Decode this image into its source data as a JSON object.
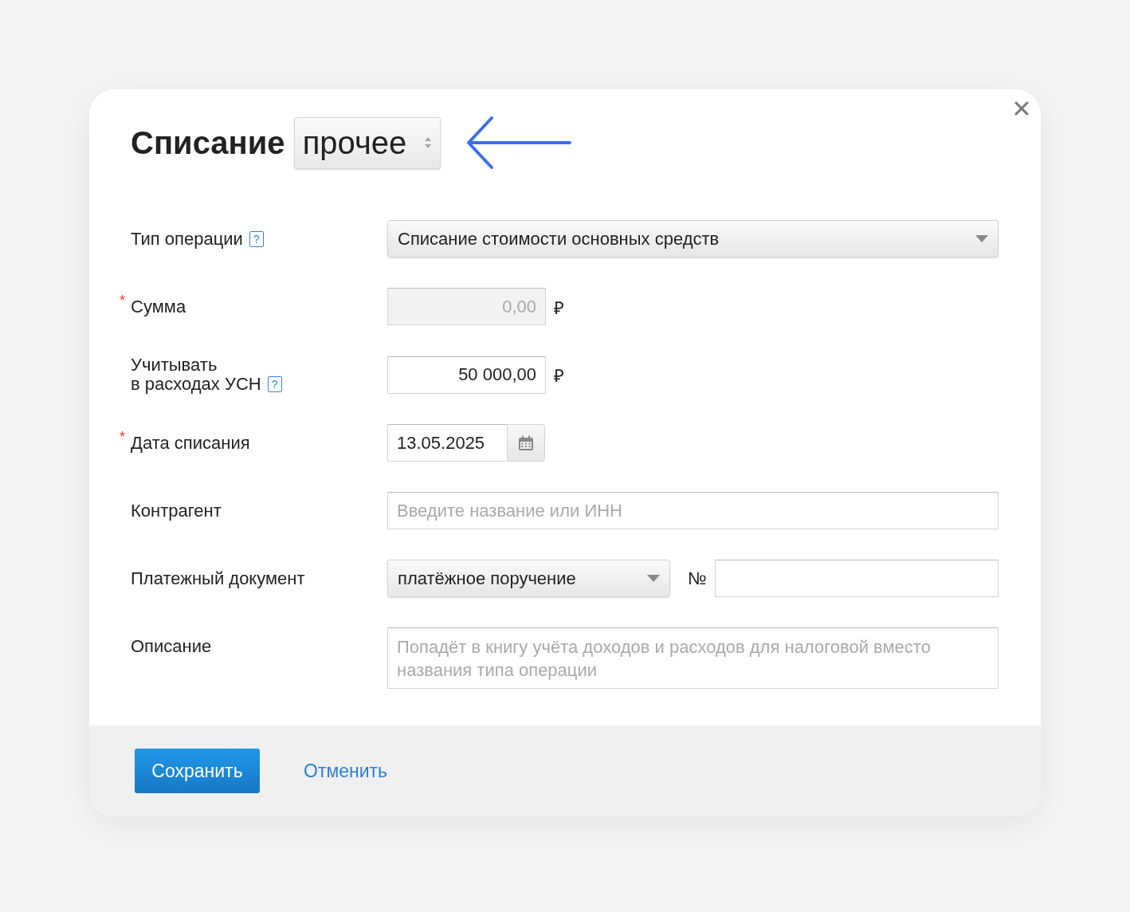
{
  "dialog": {
    "title": "Списание",
    "type_select": {
      "value": "прочее"
    }
  },
  "fields": [
    {
      "kind": "select",
      "label": "Тип операции",
      "help": "?",
      "value": "Списание стоимости основных средств"
    },
    {
      "kind": "amount",
      "label": "Сумма",
      "required_mark": "*",
      "value": "0,00",
      "disabled": true,
      "currency": "₽"
    },
    {
      "kind": "amount",
      "label": "Учитывать\nв расходах УСН",
      "help": "?",
      "value": "50 000,00",
      "disabled": false,
      "currency": "₽"
    },
    {
      "kind": "date",
      "label": "Дата списания",
      "required_mark": "*",
      "value": "13.05.2025"
    },
    {
      "kind": "text",
      "label": "Контрагент",
      "placeholder": "Введите название или ИНН"
    },
    {
      "kind": "document",
      "label": "Платежный документ",
      "value": "платёжное поручение",
      "number_label": "№"
    },
    {
      "kind": "textarea",
      "label": "Описание",
      "placeholder": "Попадёт в книгу учёта доходов и расходов для налоговой вместо названия типа операции"
    }
  ],
  "footer": {
    "save": "Сохранить",
    "cancel": "Отменить"
  }
}
